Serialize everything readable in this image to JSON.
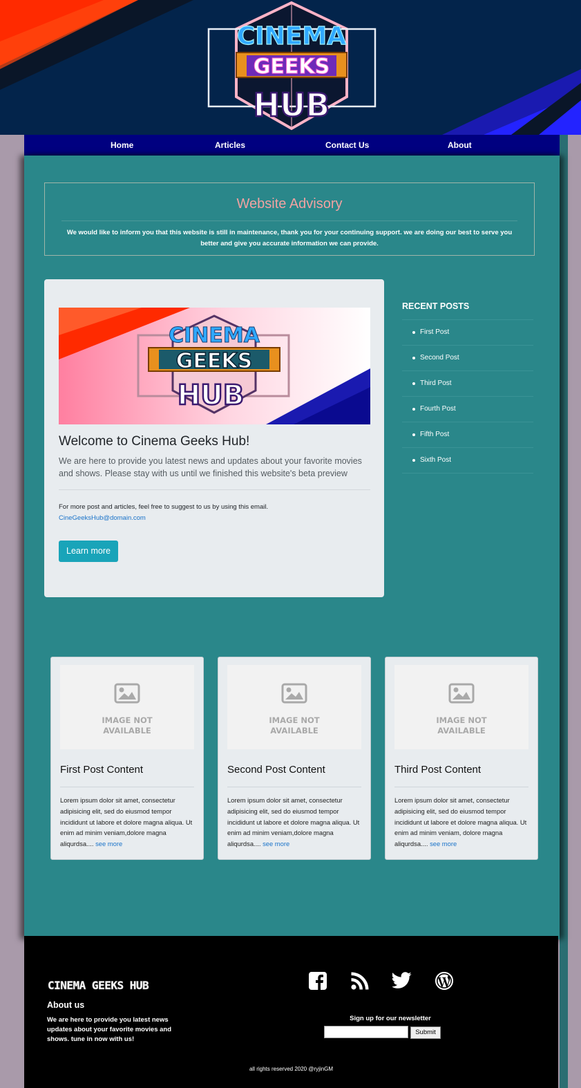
{
  "header": {
    "logo": {
      "line1": "CINEMA",
      "line2": "GEEKS",
      "line3": "HUB"
    }
  },
  "nav": {
    "items": [
      {
        "label": "Home"
      },
      {
        "label": "Articles"
      },
      {
        "label": "Contact Us"
      },
      {
        "label": "About"
      }
    ]
  },
  "advisory": {
    "title": "Website Advisory",
    "text": "We would like to inform you that this website is still in maintenance, thank you for your continuing support. we are doing our best to serve you better and give you accurate information we can provide."
  },
  "welcome": {
    "title": "Welcome to Cinema Geeks Hub!",
    "lead": "We are here to provide you latest news and updates about your favorite movies and shows. Please stay with us until we finished this website's beta preview",
    "note": "For more post and articles, feel free to suggest to us by using this email.",
    "email": "CineGeeksHub@domain.com",
    "button": "Learn more"
  },
  "recent": {
    "heading": "RECENT POSTS",
    "items": [
      "First Post",
      "Second Post",
      "Third Post",
      "Fourth Post",
      "Fifth Post",
      "Sixth Post"
    ]
  },
  "cards": [
    {
      "image_text_1": "IMAGE NOT",
      "image_text_2": "AVAILABLE",
      "title": "First Post Content",
      "body": "Lorem ipsum dolor sit amet, consectetur adipisicing elit, sed do eiusmod tempor incididunt ut labore et dolore magna aliqua. Ut enim ad minim veniam,dolore magna aliqurdsa....",
      "link": "see more"
    },
    {
      "image_text_1": "IMAGE NOT",
      "image_text_2": "AVAILABLE",
      "title": "Second Post Content",
      "body": "Lorem ipsum dolor sit amet, consectetur adipisicing elit, sed do eiusmod tempor incididunt ut labore et dolore magna aliqua. Ut enim ad minim veniam,dolore magna aliqurdsa....",
      "link": "see more"
    },
    {
      "image_text_1": "IMAGE NOT",
      "image_text_2": "AVAILABLE",
      "title": "Third Post Content",
      "body": "Lorem ipsum dolor sit amet, consectetur adipisicing elit, sed do eiusmod tempor incididunt ut labore et dolore magna aliqua. Ut enim ad minim veniam, dolore magna aliqurdsa....",
      "link": "see more"
    }
  ],
  "footer": {
    "brand": "CINEMA GEEKS HUB",
    "about_title": "About us",
    "about_text": "We are here to provide you latest news updates about your favorite movies and shows. tune in now with us!",
    "social_icons": [
      "facebook-icon",
      "rss-icon",
      "twitter-icon",
      "wordpress-icon"
    ],
    "newsletter_label": "Sign up for our newsletter",
    "newsletter_value": "",
    "submit_label": "Submit",
    "copyright": "all rights reserved 2020 @ryjinGM"
  },
  "colors": {
    "banner_bg": "#03244b",
    "nav_bg": "#000080",
    "main_bg": "#2a878a",
    "advisory_title": "#f1a2a2",
    "button": "#19a4b9",
    "link": "#1a73c9",
    "footer_bg": "#000000"
  }
}
